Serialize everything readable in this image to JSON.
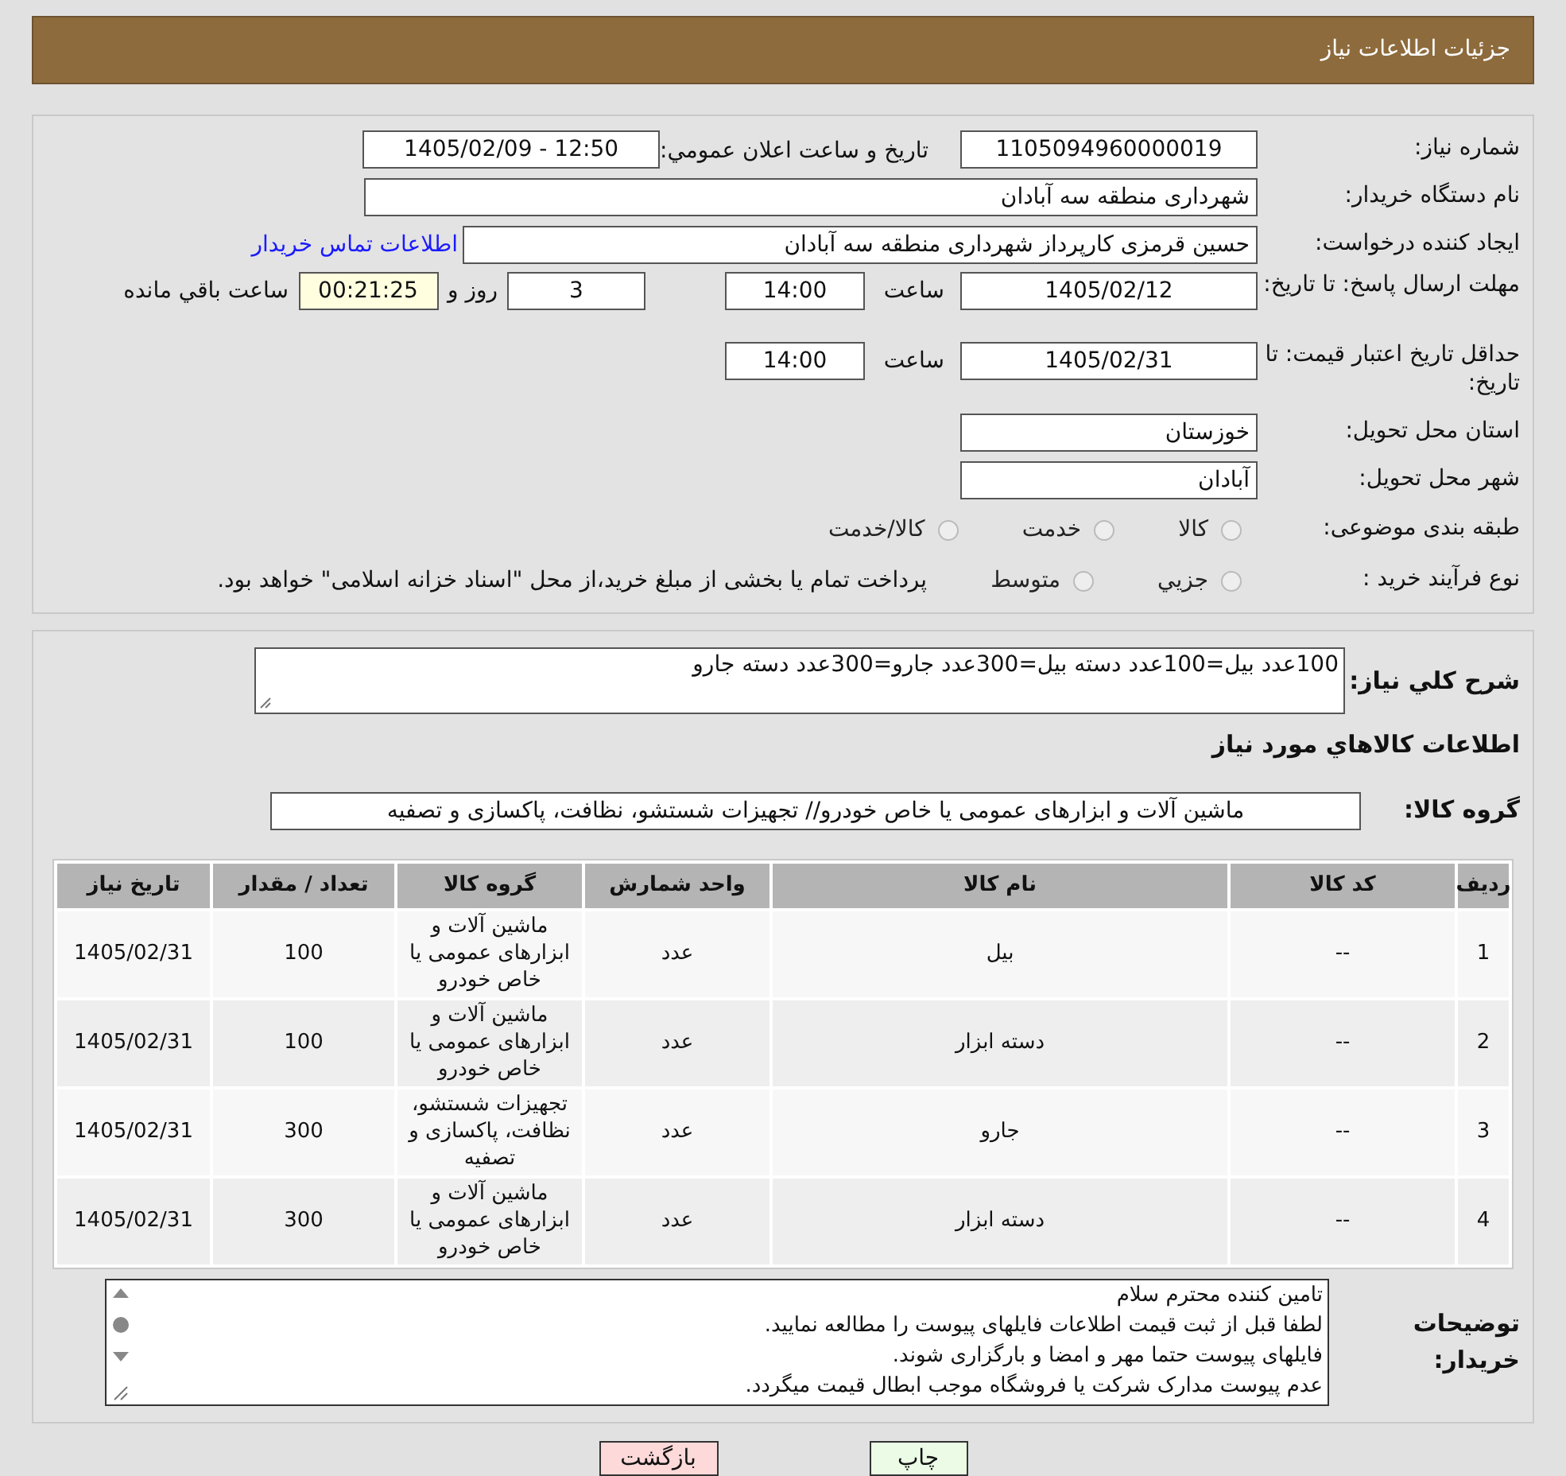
{
  "header": {
    "title": "جزئیات اطلاعات نیاز"
  },
  "info": {
    "need_number": {
      "label": "شماره نیاز:",
      "value": "1105094960000019"
    },
    "announce": {
      "label": "تاریخ و ساعت اعلان عمومي:",
      "value": "1405/02/09 - 12:50"
    },
    "buyer": {
      "label": "نام دستگاه خريدار:",
      "value": "شهرداری منطقه سه آبادان"
    },
    "requester": {
      "label": "ايجاد کننده درخواست:",
      "value": "حسین قرمزی کارپرداز شهرداری منطقه سه آبادان",
      "link": "اطلاعات تماس خريدار"
    },
    "deadline": {
      "label": "مهلت ارسال پاسخ: تا تاريخ:",
      "date": "1405/02/12",
      "time_label": "ساعت",
      "time": "14:00",
      "days": "3",
      "days_label": "روز و",
      "remaining": "00:21:25",
      "remaining_label": "ساعت باقي مانده"
    },
    "validity": {
      "label": "حداقل تاريخ اعتبار قيمت: تا تاريخ:",
      "date": "1405/02/31",
      "time_label": "ساعت",
      "time": "14:00"
    },
    "province": {
      "label": "استان محل تحويل:",
      "value": "خوزستان"
    },
    "city": {
      "label": "شهر محل تحويل:",
      "value": "آبادان"
    },
    "category": {
      "label": "طبقه بندی موضوعی:",
      "options": [
        {
          "label": "کالا",
          "selected": false
        },
        {
          "label": "خدمت",
          "selected": false
        },
        {
          "label": "کالا/خدمت",
          "selected": false
        }
      ]
    },
    "purchase": {
      "label": "نوع فرآيند خريد :",
      "options": [
        {
          "label": "جزيي",
          "selected": false
        },
        {
          "label": "متوسط",
          "selected": false
        }
      ],
      "note": "پرداخت تمام یا بخشی از مبلغ خرید،از محل \"اسناد خزانه اسلامی\" خواهد بود."
    }
  },
  "goods": {
    "summary": {
      "label": "شرح کلي نياز:",
      "value": "100عدد بیل=100عدد دسته بیل=300عدد جارو=300عدد دسته جارو"
    },
    "section_title": "اطلاعات کالاهاي مورد نياز",
    "group": {
      "label": "گروه کالا:",
      "value": "ماشین آلات و ابزارهای عمومی یا خاص خودرو// تجهیزات شستشو، نظافت، پاکسازی و تصفیه"
    },
    "table": {
      "columns": [
        "رديف",
        "کد کالا",
        "نام کالا",
        "واحد شمارش",
        "گروه کالا",
        "تعداد / مقدار",
        "تاريخ نياز"
      ],
      "rows": [
        [
          "1",
          "--",
          "بیل",
          "عدد",
          "ماشین آلات و ابزارهای عمومی یا خاص خودرو",
          "100",
          "1405/02/31"
        ],
        [
          "2",
          "--",
          "دسته ابزار",
          "عدد",
          "ماشین آلات و ابزارهای عمومی یا خاص خودرو",
          "100",
          "1405/02/31"
        ],
        [
          "3",
          "--",
          "جارو",
          "عدد",
          "تجهیزات شستشو، نظافت، پاکسازی و تصفیه",
          "300",
          "1405/02/31"
        ],
        [
          "4",
          "--",
          "دسته ابزار",
          "عدد",
          "ماشین آلات و ابزارهای عمومی یا خاص خودرو",
          "300",
          "1405/02/31"
        ]
      ]
    },
    "notes": {
      "label": "توضيحات خريدار:",
      "lines": [
        "تامین کننده محترم سلام",
        "لطفا قبل از ثبت قیمت اطلاعات فایلهای پیوست را مطالعه نمایید.",
        "فایلهای پیوست حتما مهر و امضا و بارگزاری شوند.",
        "عدم پیوست مدارک شرکت یا فروشگاه موجب ابطال قیمت میگردد."
      ]
    }
  },
  "buttons": {
    "print": "چاپ",
    "back": "بازگشت"
  }
}
